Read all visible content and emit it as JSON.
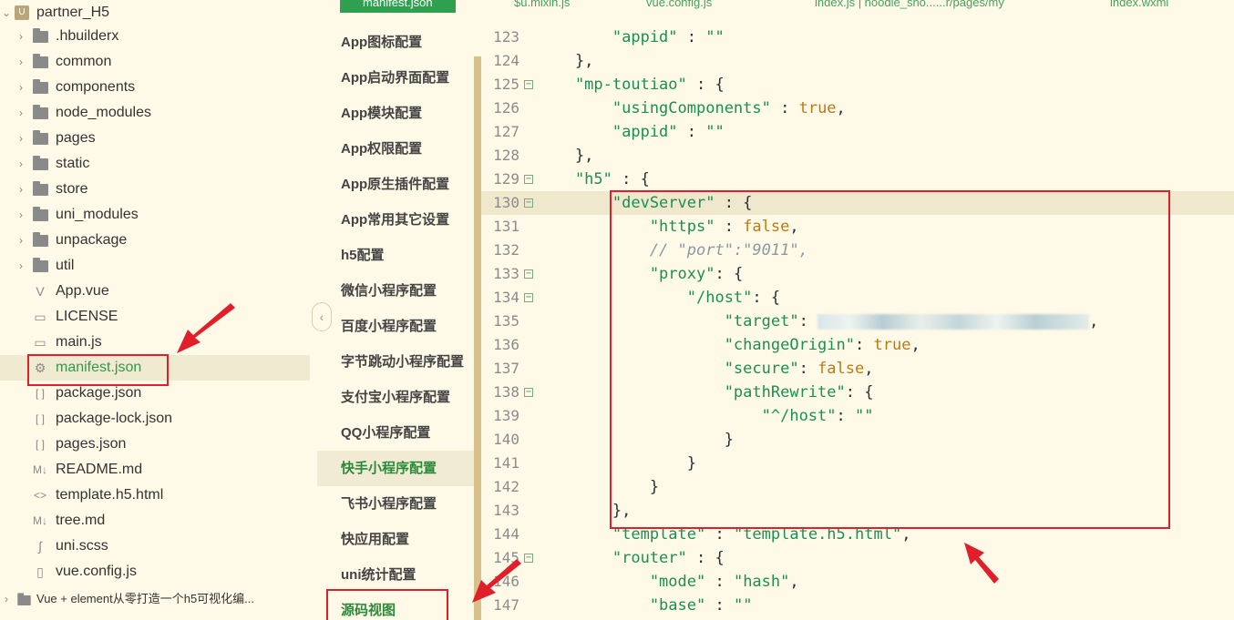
{
  "explorer": {
    "project": "partner_H5",
    "items": [
      {
        "label": ".hbuilderx",
        "type": "folder"
      },
      {
        "label": "common",
        "type": "folder"
      },
      {
        "label": "components",
        "type": "folder"
      },
      {
        "label": "node_modules",
        "type": "folder"
      },
      {
        "label": "pages",
        "type": "folder"
      },
      {
        "label": "static",
        "type": "folder"
      },
      {
        "label": "store",
        "type": "folder"
      },
      {
        "label": "uni_modules",
        "type": "folder"
      },
      {
        "label": "unpackage",
        "type": "folder"
      },
      {
        "label": "util",
        "type": "folder"
      },
      {
        "label": "App.vue",
        "type": "vue"
      },
      {
        "label": "LICENSE",
        "type": "file"
      },
      {
        "label": "main.js",
        "type": "file"
      },
      {
        "label": "manifest.json",
        "type": "manifest"
      },
      {
        "label": "package.json",
        "type": "json"
      },
      {
        "label": "package-lock.json",
        "type": "json"
      },
      {
        "label": "pages.json",
        "type": "json"
      },
      {
        "label": "README.md",
        "type": "md"
      },
      {
        "label": "template.h5.html",
        "type": "html"
      },
      {
        "label": "tree.md",
        "type": "md"
      },
      {
        "label": "uni.scss",
        "type": "scss"
      },
      {
        "label": "vue.config.js",
        "type": "js"
      }
    ],
    "other_project": "Vue + element从零打造一个h5可视化编..."
  },
  "tabs": [
    {
      "label": "manifest.json",
      "active": true
    },
    {
      "label": "$u.mixin.js"
    },
    {
      "label": "vue.config.js"
    },
    {
      "label": "index.js | noodle_sno......r/pages/my"
    },
    {
      "label": "index.wxml"
    }
  ],
  "config_nav": [
    "App图标配置",
    "App启动界面配置",
    "App模块配置",
    "App权限配置",
    "App原生插件配置",
    "App常用其它设置",
    "h5配置",
    "微信小程序配置",
    "百度小程序配置",
    "字节跳动小程序配置",
    "支付宝小程序配置",
    "QQ小程序配置",
    "快手小程序配置",
    "飞书小程序配置",
    "快应用配置",
    "uni统计配置",
    "源码视图"
  ],
  "code_lines": [
    {
      "n": "123",
      "t": [
        [
          "s",
          "        \"appid\""
        ],
        [
          "p",
          " : "
        ],
        [
          "s",
          "\"\""
        ]
      ]
    },
    {
      "n": "124",
      "t": [
        [
          "p",
          "    },"
        ]
      ]
    },
    {
      "n": "125",
      "t": [
        [
          "s",
          "    \"mp-toutiao\""
        ],
        [
          "p",
          " : {"
        ]
      ],
      "fold": true
    },
    {
      "n": "126",
      "t": [
        [
          "s",
          "        \"usingComponents\""
        ],
        [
          "p",
          " : "
        ],
        [
          "k",
          "true"
        ],
        [
          "p",
          ","
        ]
      ]
    },
    {
      "n": "127",
      "t": [
        [
          "s",
          "        \"appid\""
        ],
        [
          "p",
          " : "
        ],
        [
          "s",
          "\"\""
        ]
      ]
    },
    {
      "n": "128",
      "t": [
        [
          "p",
          "    },"
        ]
      ]
    },
    {
      "n": "129",
      "t": [
        [
          "s",
          "    \"h5\""
        ],
        [
          "p",
          " : {"
        ]
      ],
      "fold": true
    },
    {
      "n": "130",
      "t": [
        [
          "s",
          "        \"devServer\""
        ],
        [
          "p",
          " : {"
        ]
      ],
      "fold": true,
      "current": true
    },
    {
      "n": "131",
      "t": [
        [
          "s",
          "            \"https\""
        ],
        [
          "p",
          " : "
        ],
        [
          "k",
          "false"
        ],
        [
          "p",
          ","
        ]
      ]
    },
    {
      "n": "132",
      "t": [
        [
          "c",
          "            // \"port\":\"9011\","
        ]
      ]
    },
    {
      "n": "133",
      "t": [
        [
          "s",
          "            \"proxy\""
        ],
        [
          "p",
          ": {"
        ]
      ],
      "fold": true
    },
    {
      "n": "134",
      "t": [
        [
          "s",
          "                \"/host\""
        ],
        [
          "p",
          ": {"
        ]
      ],
      "fold": true
    },
    {
      "n": "135",
      "t": [
        [
          "s",
          "                    \"target\""
        ],
        [
          "p",
          ": "
        ],
        [
          "b",
          ""
        ],
        [
          "p",
          ","
        ]
      ]
    },
    {
      "n": "136",
      "t": [
        [
          "s",
          "                    \"changeOrigin\""
        ],
        [
          "p",
          ": "
        ],
        [
          "k",
          "true"
        ],
        [
          "p",
          ","
        ]
      ]
    },
    {
      "n": "137",
      "t": [
        [
          "s",
          "                    \"secure\""
        ],
        [
          "p",
          ": "
        ],
        [
          "k",
          "false"
        ],
        [
          "p",
          ","
        ]
      ]
    },
    {
      "n": "138",
      "t": [
        [
          "s",
          "                    \"pathRewrite\""
        ],
        [
          "p",
          ": {"
        ]
      ],
      "fold": true
    },
    {
      "n": "139",
      "t": [
        [
          "s",
          "                        \"^/host\""
        ],
        [
          "p",
          ": "
        ],
        [
          "s",
          "\"\""
        ]
      ]
    },
    {
      "n": "140",
      "t": [
        [
          "p",
          "                    }"
        ]
      ]
    },
    {
      "n": "141",
      "t": [
        [
          "p",
          "                }"
        ]
      ]
    },
    {
      "n": "142",
      "t": [
        [
          "p",
          "            }"
        ]
      ]
    },
    {
      "n": "143",
      "t": [
        [
          "p",
          "        },"
        ]
      ]
    },
    {
      "n": "144",
      "t": [
        [
          "s",
          "        \"template\""
        ],
        [
          "p",
          " : "
        ],
        [
          "s",
          "\"template.h5.html\""
        ],
        [
          "p",
          ","
        ]
      ]
    },
    {
      "n": "145",
      "t": [
        [
          "s",
          "        \"router\""
        ],
        [
          "p",
          " : {"
        ]
      ],
      "fold": true
    },
    {
      "n": "146",
      "t": [
        [
          "s",
          "            \"mode\""
        ],
        [
          "p",
          " : "
        ],
        [
          "s",
          "\"hash\""
        ],
        [
          "p",
          ","
        ]
      ]
    },
    {
      "n": "147",
      "t": [
        [
          "s",
          "            \"base\""
        ],
        [
          "p",
          " : "
        ],
        [
          "s",
          "\"\""
        ]
      ]
    }
  ],
  "colors": {
    "background": "#fffae8",
    "accent_green": "#2fa04f",
    "annotation_red": "#e01f2a",
    "string_green": "#1a8f54",
    "keyword_orange": "#ba7a13"
  }
}
